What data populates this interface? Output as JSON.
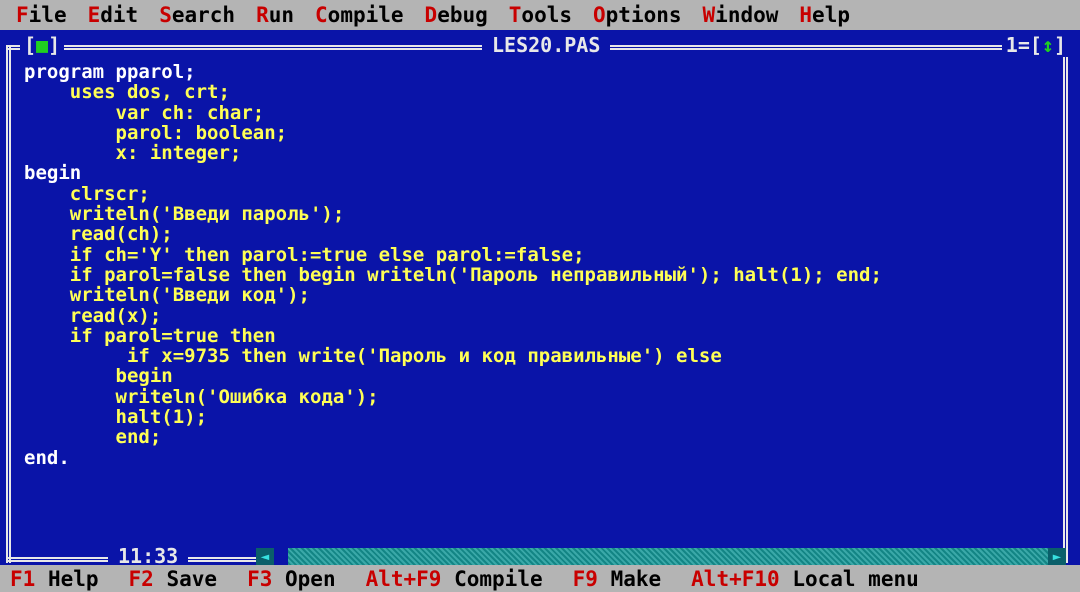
{
  "menu": [
    {
      "hot": "F",
      "rest": "ile",
      "name": "menu-file"
    },
    {
      "hot": "E",
      "rest": "dit",
      "name": "menu-edit"
    },
    {
      "hot": "S",
      "rest": "earch",
      "name": "menu-search"
    },
    {
      "hot": "R",
      "rest": "un",
      "name": "menu-run"
    },
    {
      "hot": "C",
      "rest": "ompile",
      "name": "menu-compile"
    },
    {
      "hot": "D",
      "rest": "ebug",
      "name": "menu-debug"
    },
    {
      "hot": "T",
      "rest": "ools",
      "name": "menu-tools"
    },
    {
      "hot": "O",
      "rest": "ptions",
      "name": "menu-options"
    },
    {
      "hot": "W",
      "rest": "indow",
      "name": "menu-window"
    },
    {
      "hot": "H",
      "rest": "elp",
      "name": "menu-help"
    }
  ],
  "window": {
    "title": "LES20.PAS",
    "close_glyph": "■",
    "number": "1",
    "zoom_glyph": "↕",
    "cursor_position": "11:33"
  },
  "code_lines": [
    "program pparol;",
    "    uses dos, crt;",
    "        var ch: char;",
    "        parol: boolean;",
    "        x: integer;",
    "begin",
    "    clrscr;",
    "    writeln('Введи пароль');",
    "    read(ch);",
    "    if ch='Y' then parol:=true else parol:=false;",
    "    if parol=false then begin writeln('Пароль неправильный'); halt(1); end;",
    "    writeln('Введи код');",
    "    read(x);",
    "    if parol=true then",
    "         if x=9735 then write('Пароль и код правильные') else",
    "        begin",
    "        writeln('Ошибка кода');",
    "        halt(1);",
    "        end;",
    "end."
  ],
  "status": [
    {
      "key": "F1",
      "label": "Help",
      "name": "status-help"
    },
    {
      "key": "F2",
      "label": "Save",
      "name": "status-save"
    },
    {
      "key": "F3",
      "label": "Open",
      "name": "status-open"
    },
    {
      "key": "Alt+F9",
      "label": "Compile",
      "name": "status-compile"
    },
    {
      "key": "F9",
      "label": "Make",
      "name": "status-make"
    },
    {
      "key": "Alt+F10",
      "label": "Local menu",
      "name": "status-local-menu"
    }
  ],
  "colors": {
    "editor_bg": "#0a14a8",
    "code_text": "#ffff55",
    "keyword_white": "#ffffff",
    "menu_bg": "#b4b4b4",
    "hotkey": "#c80000",
    "frame": "#e8e8e8",
    "scrollbar": "#1a8a8a"
  }
}
